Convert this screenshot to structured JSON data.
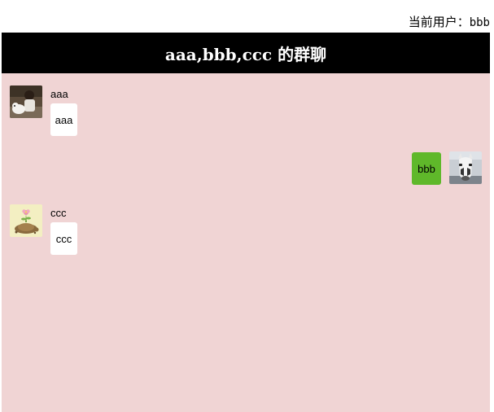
{
  "current_user": {
    "label": "当前用户：",
    "name": "bbb"
  },
  "chat": {
    "title": "aaa,bbb,ccc 的群聊"
  },
  "messages": [
    {
      "sender": "aaa",
      "text": "aaa",
      "is_self": false,
      "avatar_icon": "person-with-dog-photo-avatar"
    },
    {
      "sender": "bbb",
      "text": "bbb",
      "is_self": true,
      "avatar_icon": "white-horse-photo-avatar"
    },
    {
      "sender": "ccc",
      "text": "ccc",
      "is_self": false,
      "avatar_icon": "flower-turtle-illustration-avatar"
    }
  ],
  "colors": {
    "header_bg": "#000000",
    "header_text": "#ffffff",
    "chat_bg": "#f0d4d4",
    "other_bubble": "#ffffff",
    "self_bubble": "#5fb82a"
  }
}
